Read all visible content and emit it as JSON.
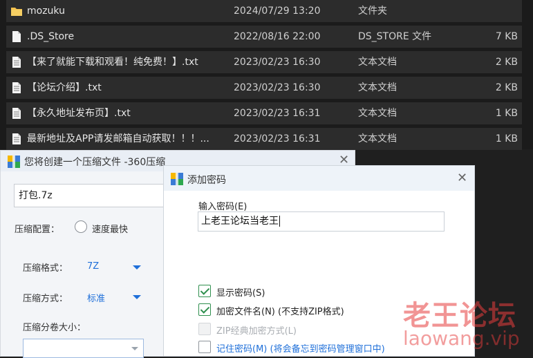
{
  "colors": {
    "accent": "#1e6fd9",
    "check": "#2f8f4e",
    "folder": "#f2c14e",
    "watermark": "#e63c3c"
  },
  "files": [
    {
      "icon": "folder-icon",
      "name": "mozuku",
      "date": "2024/07/29 13:20",
      "type": "文件夹",
      "size": ""
    },
    {
      "icon": "file-icon",
      "name": ".DS_Store",
      "date": "2022/08/16 22:00",
      "type": "DS_STORE 文件",
      "size": "7 KB"
    },
    {
      "icon": "text-file-icon",
      "name": "【来了就能下载和观看！纯免费！】.txt",
      "date": "2023/02/23 16:30",
      "type": "文本文档",
      "size": "2 KB"
    },
    {
      "icon": "text-file-icon",
      "name": "【论坛介绍】.txt",
      "date": "2023/02/23 16:30",
      "type": "文本文档",
      "size": "2 KB"
    },
    {
      "icon": "text-file-icon",
      "name": "【永久地址发布页】.txt",
      "date": "2023/02/23 16:31",
      "type": "文本文档",
      "size": "1 KB"
    },
    {
      "icon": "text-file-icon",
      "name": "最新地址及APP请发邮箱自动获取！！！...",
      "date": "2023/02/23 16:31",
      "type": "文本文档",
      "size": "1 KB"
    }
  ],
  "compress": {
    "title": "您将创建一个压缩文件 -360压缩",
    "filename": "打包.7z",
    "config_label": "压缩配置：",
    "speed_option": "速度最快",
    "format_label": "压缩格式：",
    "format_value": "7Z",
    "method_label": "压缩方式：",
    "method_value": "标准",
    "split_label": "压缩分卷大小："
  },
  "password": {
    "title": "添加密码",
    "input_label": "输入密码(E)",
    "input_value": "上老王论坛当老王",
    "options": [
      {
        "label": "显示密码(S)",
        "checked": true,
        "disabled": false,
        "style": "normal"
      },
      {
        "label": "加密文件名(N) (不支持ZIP格式)",
        "checked": true,
        "disabled": false,
        "style": "normal"
      },
      {
        "label": "ZIP经典加密方式(L)",
        "checked": false,
        "disabled": true,
        "style": "disabled"
      },
      {
        "label": "记住密码(M) (将会备忘到密码管理窗口中)",
        "checked": false,
        "disabled": false,
        "style": "link"
      }
    ]
  },
  "watermark": {
    "cn": "老王论坛",
    "en": "laowang.vip"
  }
}
